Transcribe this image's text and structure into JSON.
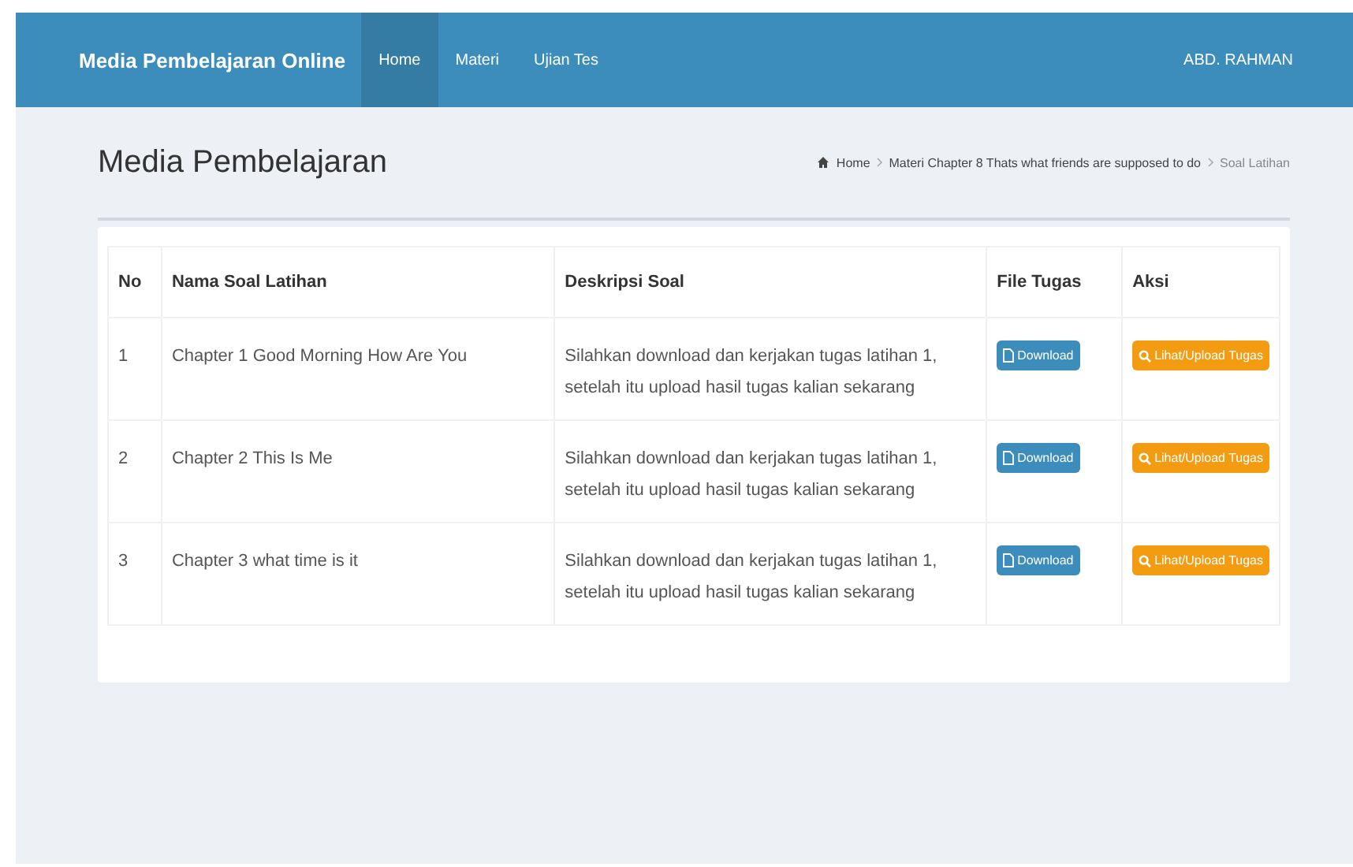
{
  "navbar": {
    "brand": "Media Pembelajaran Online",
    "menu": [
      {
        "label": "Home",
        "selected": true
      },
      {
        "label": "Materi",
        "selected": false
      },
      {
        "label": "Ujian Tes",
        "selected": false
      }
    ],
    "user": "ABD. RAHMAN"
  },
  "page_title": "Media Pembelajaran",
  "breadcrumb": [
    "Home",
    "Materi Chapter 8 Thats what friends are supposed to do",
    "Soal Latihan"
  ],
  "table": {
    "columns": [
      "No",
      "Nama Soal Latihan",
      "Deskripsi Soal",
      "File Tugas",
      "Aksi"
    ],
    "rows": [
      {
        "no": "1",
        "name": "Chapter 1 Good Morning How Are You",
        "description": "Silahkan download dan kerjakan tugas latihan 1, setelah itu upload hasil tugas kalian sekarang",
        "download": "Download",
        "action": "Lihat/Upload Tugas"
      },
      {
        "no": "2",
        "name": "Chapter 2 This Is Me",
        "description": "Silahkan download dan kerjakan tugas latihan 1, setelah itu upload hasil tugas kalian sekarang",
        "download": "Download",
        "action": "Lihat/Upload Tugas"
      },
      {
        "no": "3",
        "name": "Chapter 3 what time is it",
        "description": "Silahkan download dan kerjakan tugas latihan 1, setelah itu upload hasil tugas kalian sekarang",
        "download": "Download",
        "action": "Lihat/Upload Tugas"
      }
    ]
  }
}
